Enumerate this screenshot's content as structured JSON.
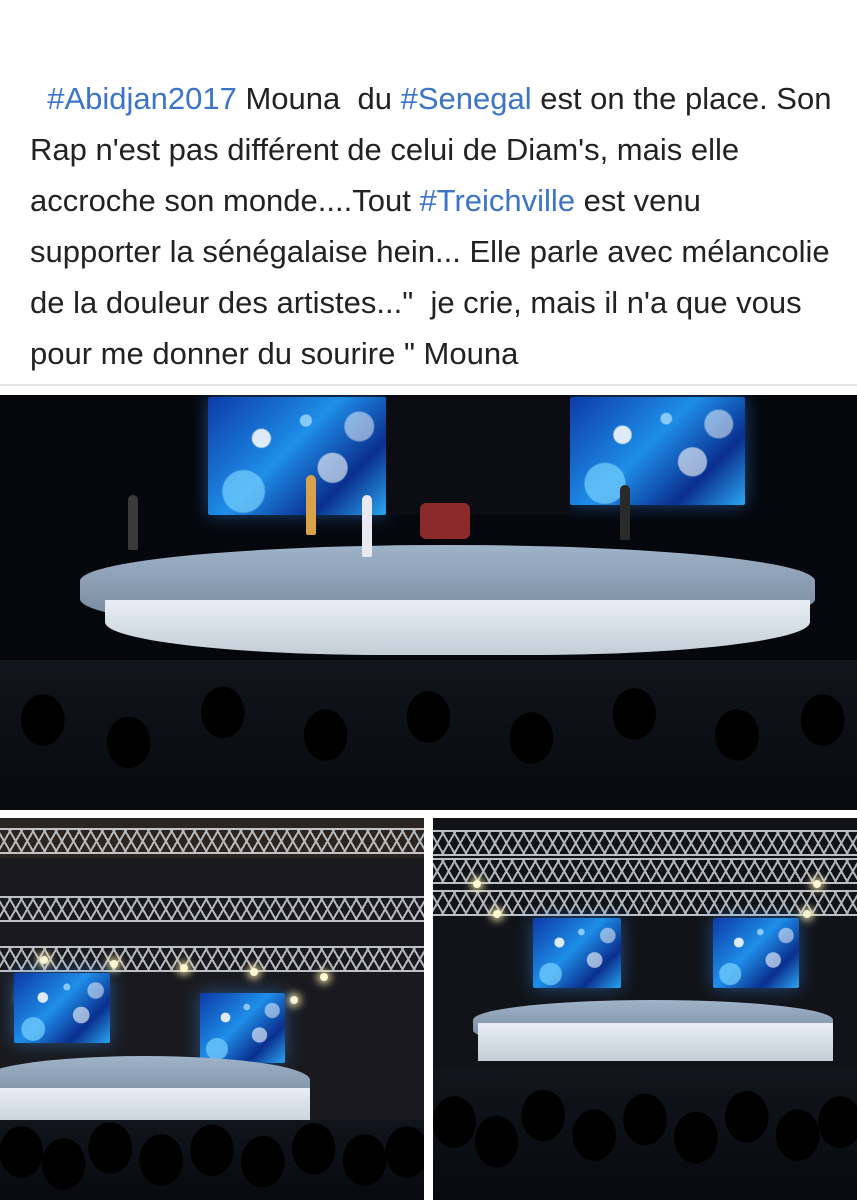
{
  "post": {
    "segments": [
      {
        "text": "#Abidjan2017",
        "type": "hashtag"
      },
      {
        "text": " Mouna  du ",
        "type": "text"
      },
      {
        "text": "#Senegal",
        "type": "hashtag"
      },
      {
        "text": " est on the place. Son Rap n'est pas différent de celui de Diam's, mais elle accroche son monde....Tout ",
        "type": "text"
      },
      {
        "text": "#Treichville",
        "type": "hashtag"
      },
      {
        "text": " est venu supporter la sénégalaise hein... Elle parle avec mélancolie de la douleur des artistes...\"  je crie, mais il n'a que vous pour me donner du sourire \" Mouna",
        "type": "text"
      }
    ]
  },
  "colors": {
    "hashtag": "#3b74c9",
    "text": "#222222",
    "background": "#ffffff"
  },
  "photos": [
    {
      "id": "main",
      "subject": "concert-stage-photo"
    },
    {
      "id": "left",
      "subject": "concert-hall-wide-photo"
    },
    {
      "id": "right",
      "subject": "concert-hall-wide-photo"
    }
  ]
}
